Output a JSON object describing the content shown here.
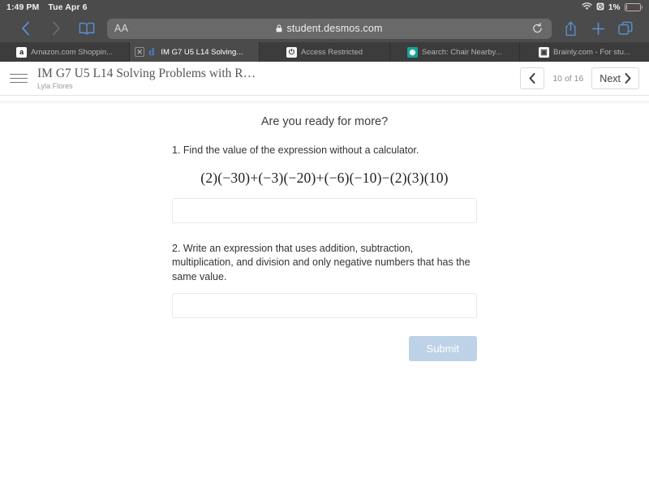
{
  "status_bar": {
    "time": "1:49 PM",
    "date": "Tue Apr 6",
    "battery_percent": "1%",
    "icons": [
      "wifi-icon",
      "alarm-icon",
      "battery-icon"
    ]
  },
  "browser": {
    "back_icon": "chevron-left-icon",
    "forward_icon": "chevron-right-icon",
    "bookmarks_icon": "book-icon",
    "text_size_label": "AA",
    "lock_icon": "lock-icon",
    "url": "student.desmos.com",
    "reload_icon": "reload-icon",
    "share_icon": "share-icon",
    "new_tab_icon": "plus-icon",
    "tabs_icon": "tabs-icon",
    "accent_color": "#5a8fd6",
    "chrome_color": "#4b4b4b"
  },
  "tabs": [
    {
      "label": "Amazon.com Shoppin...",
      "favicon": "amazon-favicon",
      "favicon_glyph": "a",
      "active": false,
      "closeable": false
    },
    {
      "label": "IM G7 U5 L14 Solving...",
      "favicon": "desmos-favicon",
      "favicon_glyph": "d",
      "active": true,
      "closeable": true
    },
    {
      "label": "Access Restricted",
      "favicon": "power-favicon",
      "favicon_glyph": "⏻",
      "active": false,
      "closeable": false
    },
    {
      "label": "Search: Chair Nearby...",
      "favicon": "teal-circle-favicon",
      "favicon_glyph": "◉",
      "active": false,
      "closeable": false
    },
    {
      "label": "Brainly.com - For stu...",
      "favicon": "brainly-favicon",
      "favicon_glyph": "▣",
      "active": false,
      "closeable": false
    }
  ],
  "app_header": {
    "menu_icon": "hamburger-menu-icon",
    "lesson_title": "IM G7 U5 L14 Solving Problems with R…",
    "student_name": "Lyla Flores",
    "prev_icon": "‹",
    "page_indicator": "10 of 16",
    "next_label": "Next",
    "next_icon": "›"
  },
  "activity": {
    "heading": "Are you ready for more?",
    "question1": {
      "prompt": "1. Find the value of the expression without a calculator.",
      "expression": "(2)(−30)+(−3)(−20)+(−6)(−10)−(2)(3)(10)",
      "answer_value": "",
      "answer_placeholder": ""
    },
    "question2": {
      "prompt": "2. Write an expression that uses addition, subtraction, multiplication, and division and only negative numbers that has the same value.",
      "answer_value": "",
      "answer_placeholder": ""
    },
    "submit_label": "Submit",
    "submit_color": "#bdd2e6"
  }
}
